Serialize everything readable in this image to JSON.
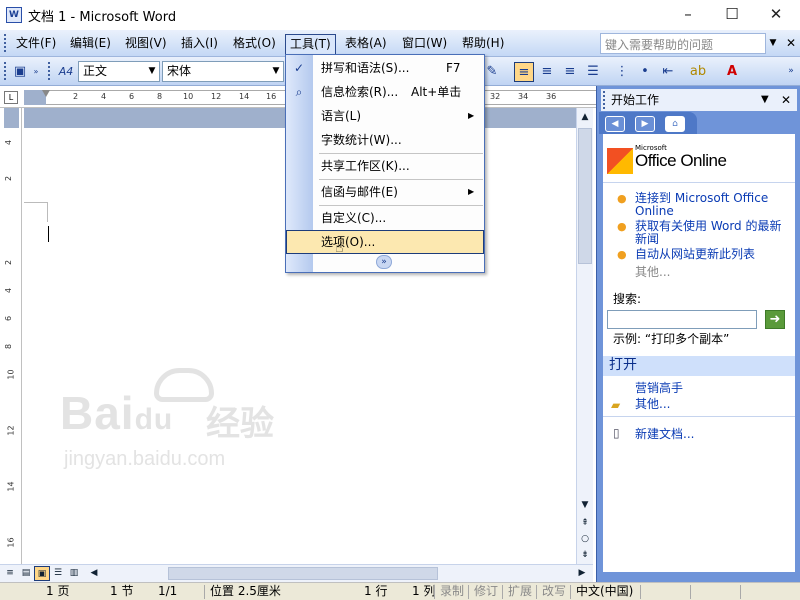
{
  "app": {
    "title": "文档 1 - Microsoft Word",
    "icon": "word-doc-icon"
  },
  "window": {
    "minimize": "–",
    "maximize": "☐",
    "close": "✕"
  },
  "menubar": {
    "items": [
      {
        "label": "文件(F)"
      },
      {
        "label": "编辑(E)"
      },
      {
        "label": "视图(V)"
      },
      {
        "label": "插入(I)"
      },
      {
        "label": "格式(O)"
      },
      {
        "label": "工具(T)"
      },
      {
        "label": "表格(A)"
      },
      {
        "label": "窗口(W)"
      },
      {
        "label": "帮助(H)"
      }
    ],
    "help_placeholder": "键入需要帮助的问题"
  },
  "formatting": {
    "style": "正文",
    "font": "宋体",
    "style_icon": "A4"
  },
  "ruler": {
    "ticks": [
      "2",
      "4",
      "6",
      "8",
      "10",
      "12",
      "14",
      "16",
      "32",
      "34",
      "36"
    ]
  },
  "vruler": {
    "ticks": [
      "4",
      "2",
      "2",
      "4",
      "6",
      "8",
      "10",
      "12",
      "14",
      "16"
    ]
  },
  "tools_menu": {
    "items": [
      {
        "label": "拼写和语法(S)...",
        "shortcut": "F7",
        "icon": "spellcheck-icon"
      },
      {
        "label": "信息检索(R)...",
        "shortcut": "Alt+单击",
        "icon": "research-icon"
      },
      {
        "label": "语言(L)",
        "submenu": true
      },
      {
        "label": "字数统计(W)..."
      },
      {
        "label": "共享工作区(K)..."
      },
      {
        "label": "信函与邮件(E)",
        "submenu": true
      },
      {
        "label": "自定义(C)..."
      },
      {
        "label": "选项(O)...",
        "highlighted": true
      }
    ],
    "expand": "»"
  },
  "taskpane": {
    "title": "开始工作",
    "brand_small": "Microsoft",
    "brand": "Office Online",
    "links": [
      "连接到 Microsoft Office Online",
      "获取有关使用 Word 的最新新闻",
      "自动从网站更新此列表"
    ],
    "more": "其他...",
    "search_label": "搜索:",
    "example": "示例:  “打印多个副本”",
    "open_title": "打开",
    "recent": "营销高手",
    "open_more": "其他...",
    "new_doc": "新建文档..."
  },
  "status": {
    "page": "1 页",
    "section": "1 节",
    "page_of": "1/1",
    "position": "位置 2.5厘米",
    "line": "1 行",
    "column": "1 列",
    "rec": "录制",
    "trk": "修订",
    "ext": "扩展",
    "ovr": "改写",
    "lang": "中文(中国)"
  },
  "watermark": {
    "brand": "Bai",
    "brand2": "du",
    "cn": "经验",
    "url": "jingyan.baidu.com"
  }
}
